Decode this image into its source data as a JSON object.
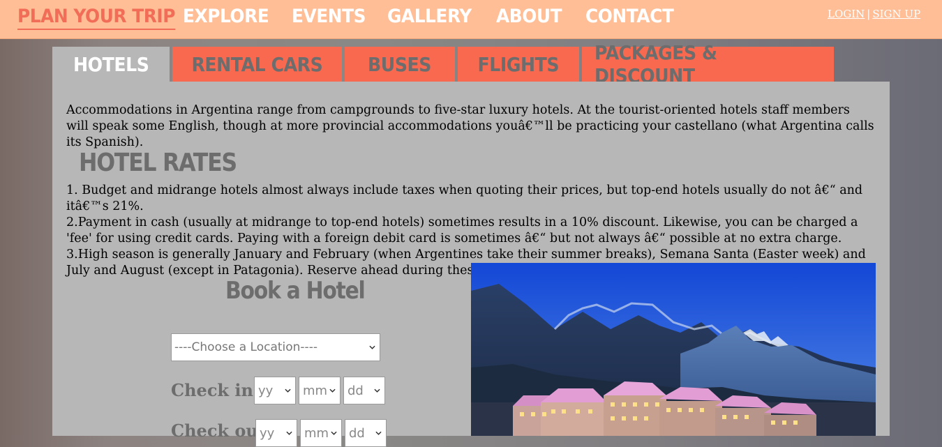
{
  "nav": {
    "brand": "PLAN YOUR TRIP",
    "items": [
      "EXPLORE",
      "EVENTS",
      "GALLERY",
      "ABOUT",
      "CONTACT"
    ],
    "login": "LOGIN",
    "separator": "|",
    "signup": "SIGN UP"
  },
  "tabs": [
    "HOTELS",
    "RENTAL CARS",
    "BUSES",
    "FLIGHTS",
    "PACKAGES & DISCOUNT"
  ],
  "content": {
    "intro": "Accommodations in Argentina range from campgrounds to five-star luxury hotels. At the tourist-oriented hotels staff members will speak some English, though at more provincial accommodations youâ€™ll be practicing your castellano (what Argentina calls its Spanish).",
    "rates_heading": "HOTEL RATES",
    "rates": [
      "1. Budget and midrange hotels almost always include taxes when quoting their prices, but top-end hotels usually do not â€“ and itâ€™s 21%.",
      "2.Payment in cash (usually at midrange to top-end hotels) sometimes results in a 10% discount. Likewise, you can be charged a 'fee' for using credit cards. Paying with a foreign debit card is sometimes â€“ but not always â€“ possible at no extra charge.",
      "3.High season is generally January and February (when Argentines take their summer breaks), Semana Santa (Easter week) and July and August (except in Patagonia). Reserve ahead during these times."
    ]
  },
  "booking": {
    "heading": "Book a Hotel",
    "location_placeholder": "----Choose a Location----",
    "checkin_label": "Check in:",
    "checkout_label": "Check out:",
    "yy": "yy",
    "mm": "mm",
    "dd": "dd"
  },
  "colors": {
    "topbar": "#ffbe95",
    "accent": "#f26d57",
    "tab": "#f8694f",
    "panel": "#b7b7b7",
    "heading_gray": "#6e6d6d"
  }
}
